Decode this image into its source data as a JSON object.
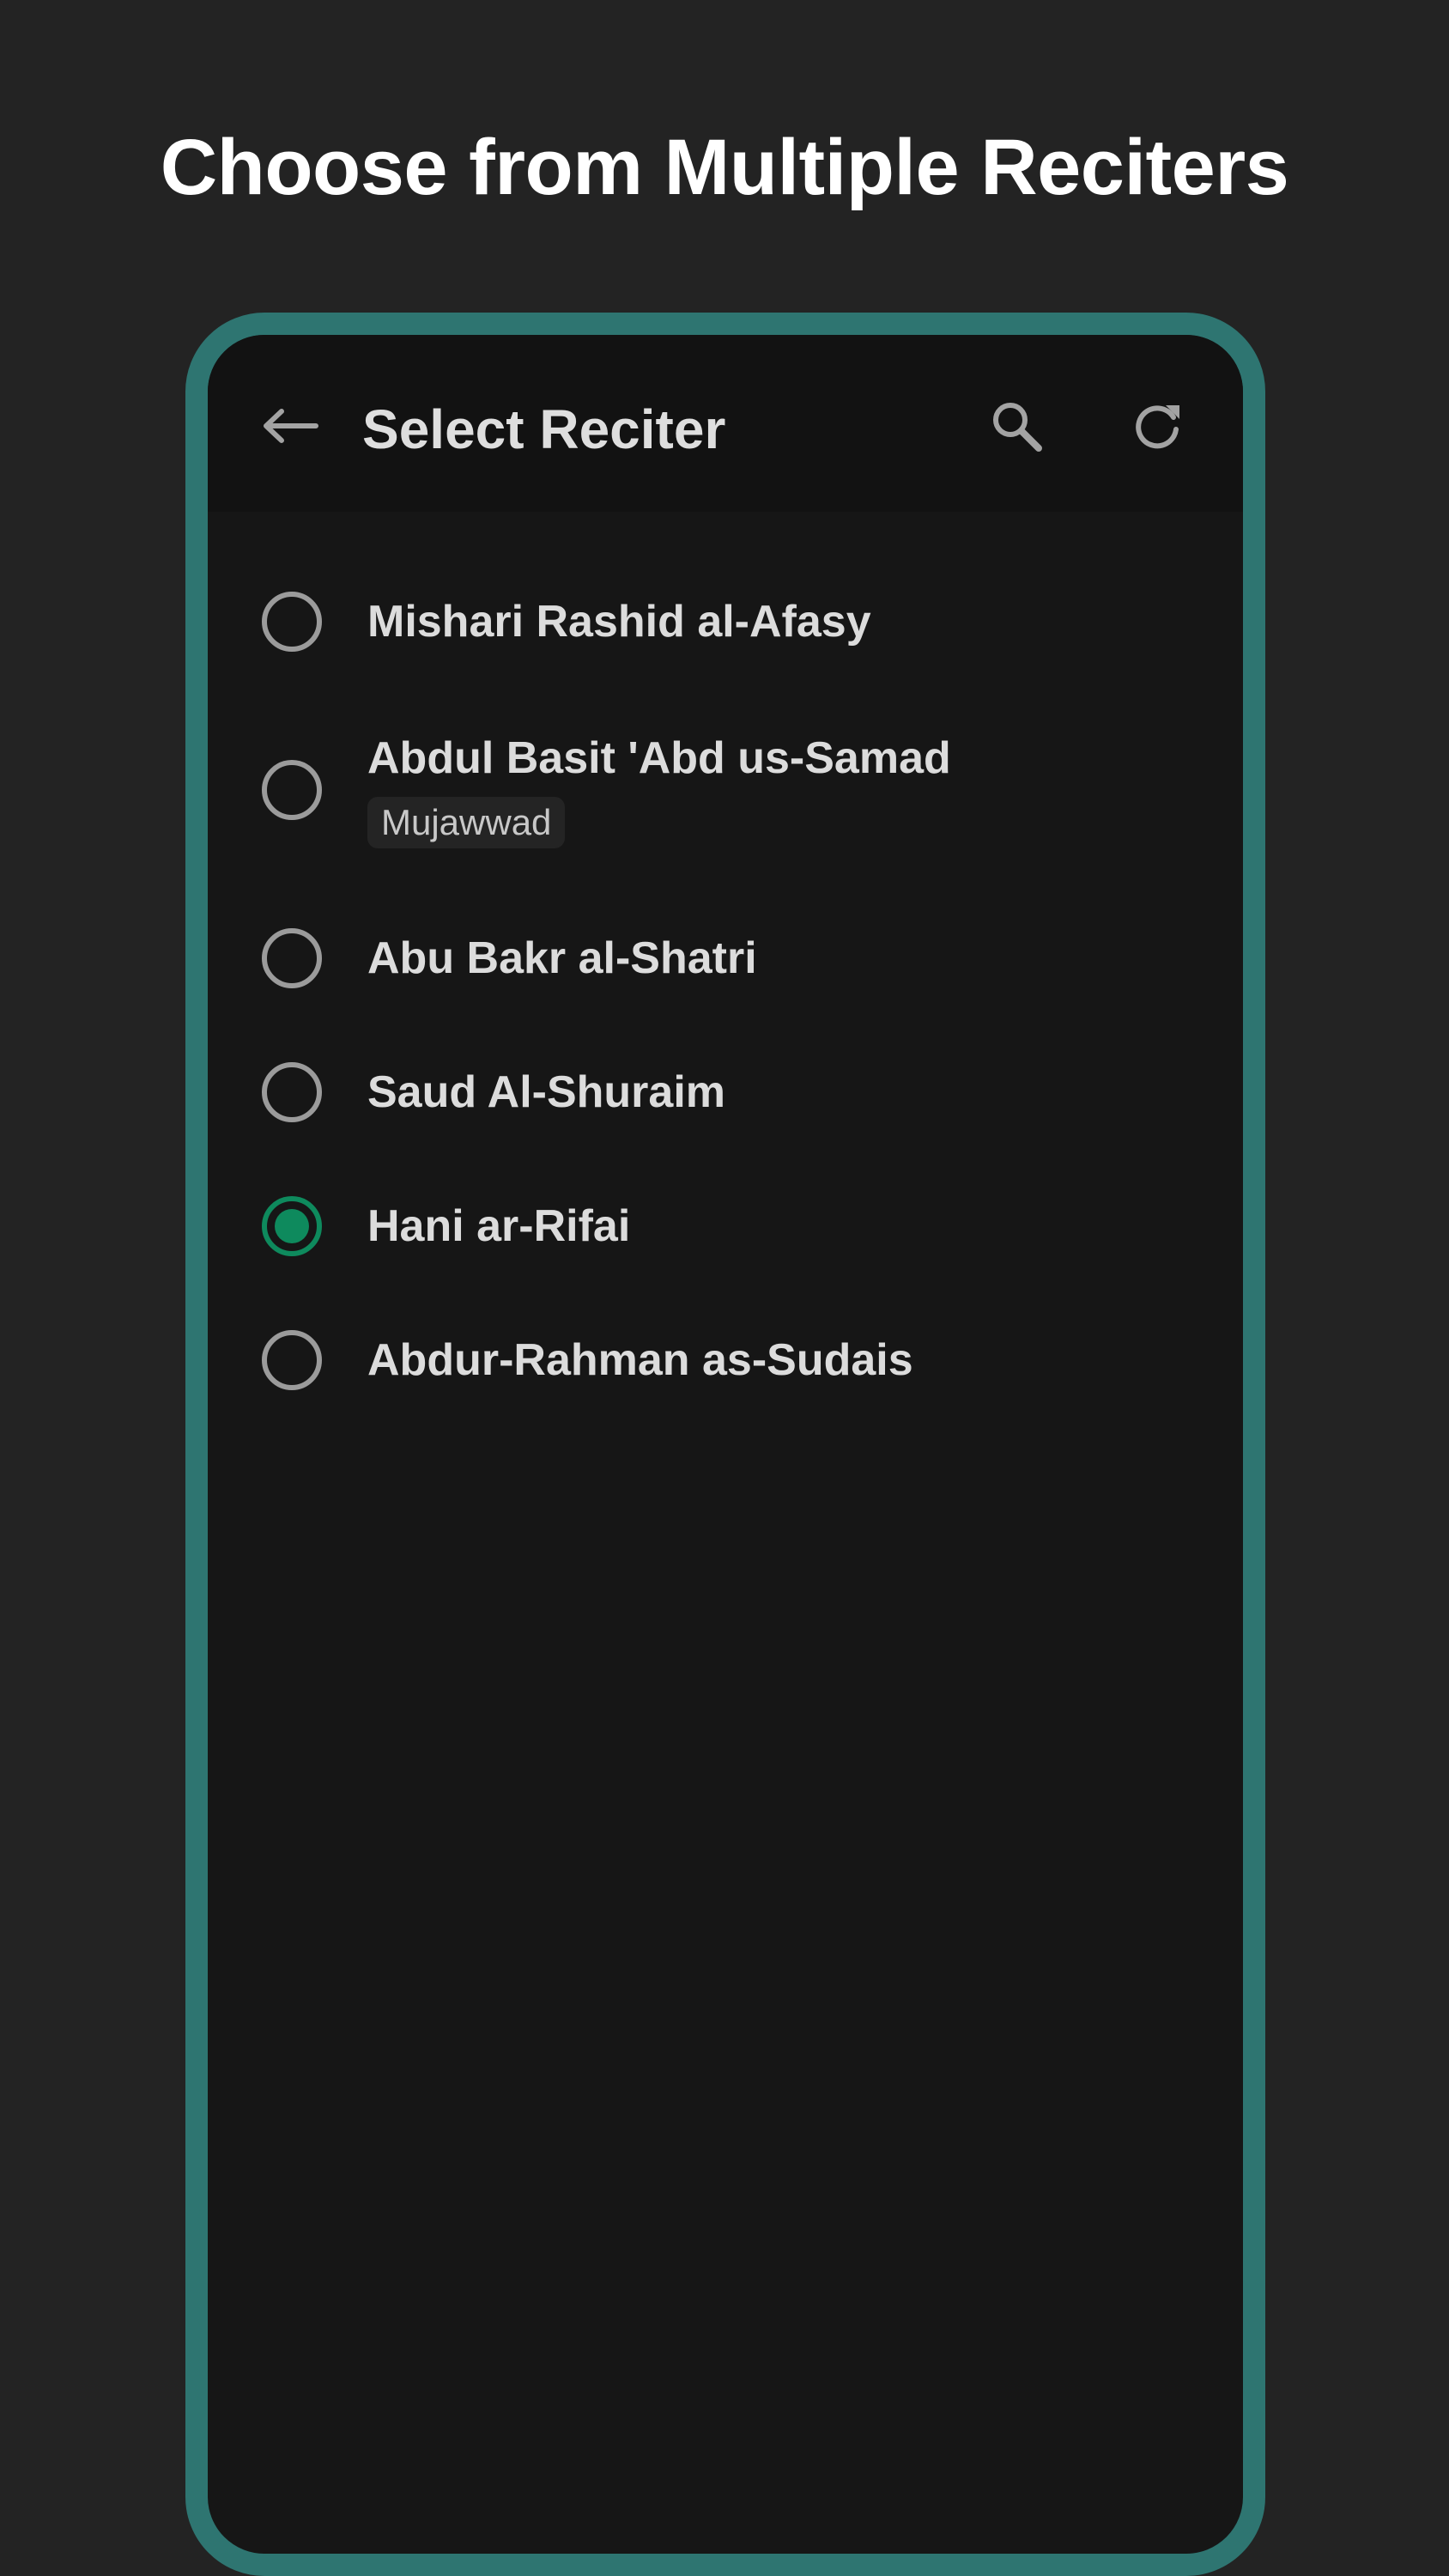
{
  "headline": "Choose from Multiple Reciters",
  "appbar": {
    "title": "Select Reciter",
    "back_icon": "arrow-left-icon",
    "search_icon": "search-icon",
    "refresh_icon": "refresh-icon"
  },
  "colors": {
    "frame": "#2e7571",
    "accent": "#0e8a5d",
    "background": "#232323",
    "screen": "#161616"
  },
  "reciters": [
    {
      "name": "Mishari Rashid al-Afasy",
      "tag": "",
      "selected": false
    },
    {
      "name": "Abdul Basit 'Abd us-Samad",
      "tag": "Mujawwad",
      "selected": false
    },
    {
      "name": "Abu Bakr al-Shatri",
      "tag": "",
      "selected": false
    },
    {
      "name": "Saud Al-Shuraim",
      "tag": "",
      "selected": false
    },
    {
      "name": "Hani ar-Rifai",
      "tag": "",
      "selected": true
    },
    {
      "name": "Abdur-Rahman as-Sudais",
      "tag": "",
      "selected": false
    }
  ]
}
